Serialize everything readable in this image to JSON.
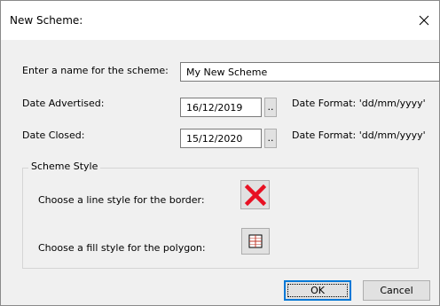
{
  "window": {
    "title": "New Scheme:",
    "close_icon": "close-icon"
  },
  "form": {
    "name_label": "Enter a name for the scheme:",
    "name_value": "My New Scheme",
    "advertised_label": "Date Advertised:",
    "advertised_value": "16/12/2019",
    "advertised_format": "Date Format: 'dd/mm/yyyy'",
    "closed_label": "Date Closed:",
    "closed_value": "15/12/2020",
    "closed_format": "Date Format: 'dd/mm/yyyy'",
    "date_picker_label": ".."
  },
  "scheme_style": {
    "title": "Scheme Style",
    "border_label": "Choose a line style for the border:",
    "fill_label": "Choose a fill style for the polygon:",
    "border_icon": "red-x-icon",
    "fill_icon": "grid-fill-icon"
  },
  "buttons": {
    "ok": "OK",
    "cancel": "Cancel"
  },
  "colors": {
    "accent": "#0078d7",
    "border_x": "#e81123",
    "fill_grid": "#c0392b"
  }
}
